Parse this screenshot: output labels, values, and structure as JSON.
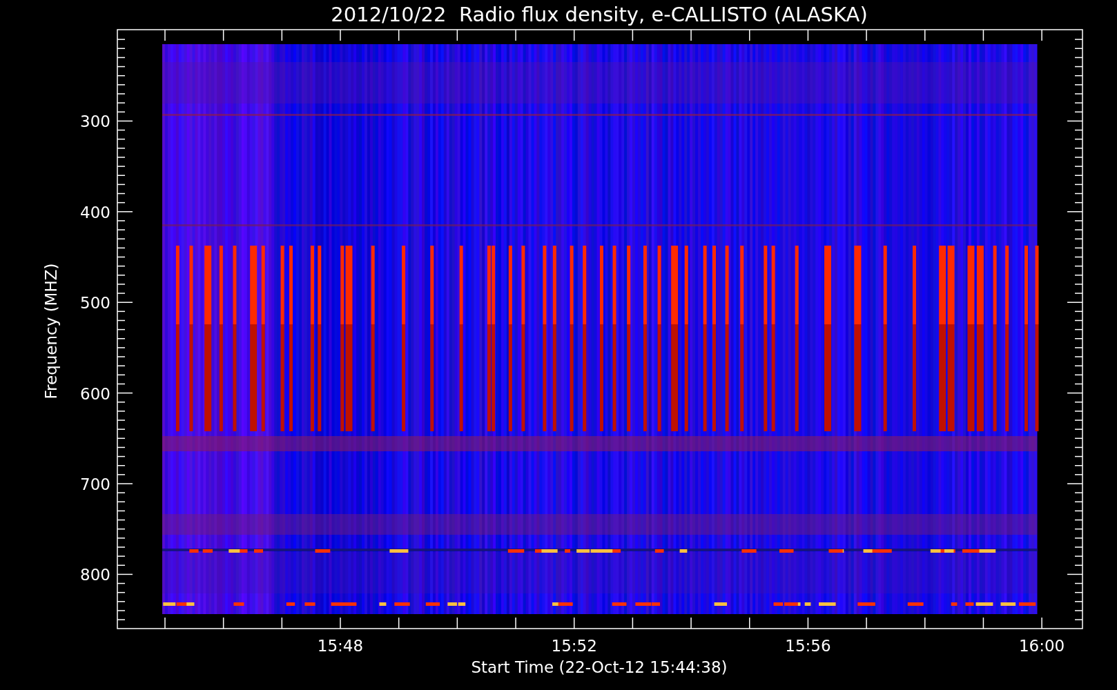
{
  "plot": {
    "title": "2012/10/22  Radio flux density, e-CALLISTO (ALASKA)",
    "ylabel": "Frequency (MHZ)",
    "xlabel": "Start Time (22-Oct-12 15:44:38)",
    "yticks": [
      "300",
      "400",
      "500",
      "600",
      "700",
      "800"
    ],
    "xticks": [
      "15:48",
      "15:52",
      "15:56",
      "16:00"
    ]
  }
}
